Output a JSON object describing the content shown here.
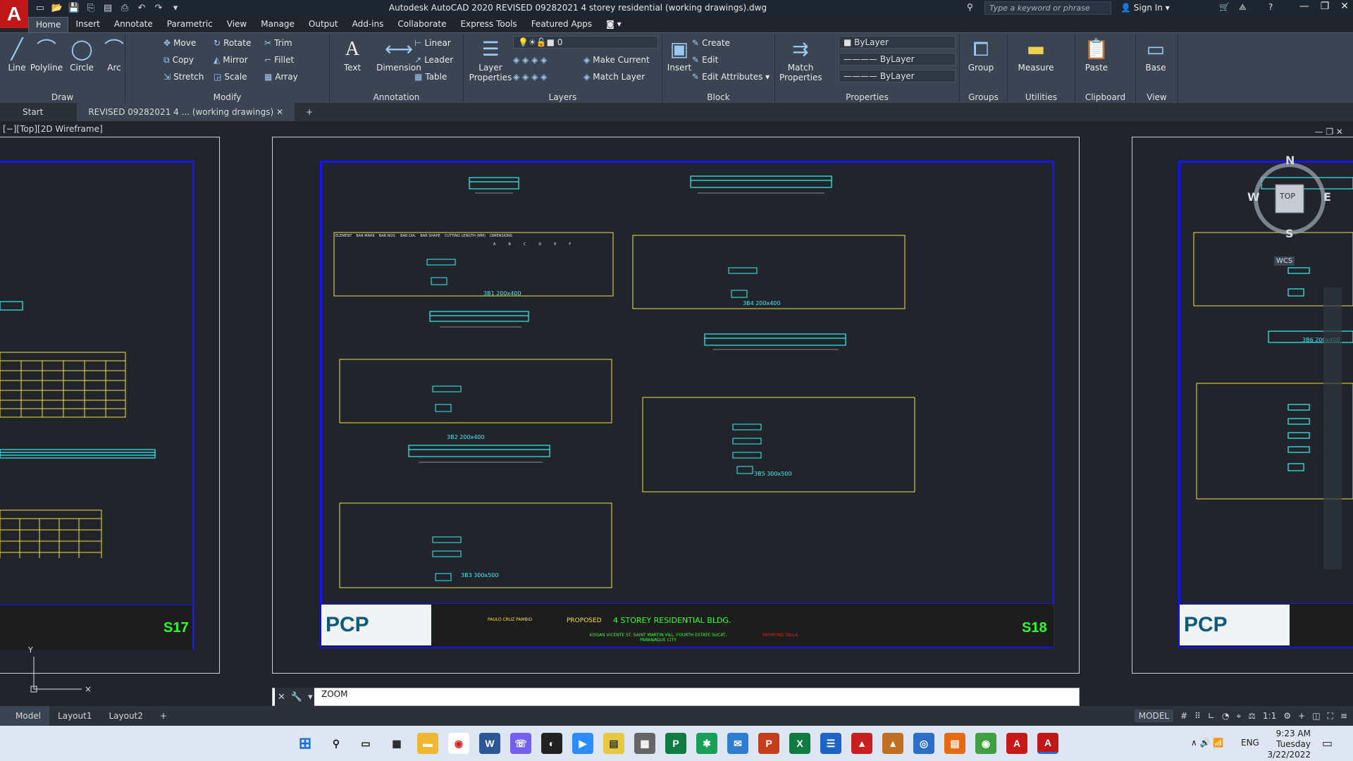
{
  "app": {
    "logo": "A",
    "title": "Autodesk AutoCAD 2020    REVISED 09282021 4 storey residential (working drawings).dwg"
  },
  "header": {
    "search_placeholder": "Type a keyword or phrase",
    "sign_in": "Sign In"
  },
  "ribbon_tabs": [
    "Home",
    "Insert",
    "Annotate",
    "Parametric",
    "View",
    "Manage",
    "Output",
    "Add-ins",
    "Collaborate",
    "Express Tools",
    "Featured Apps"
  ],
  "panels": {
    "draw": {
      "title": "Draw",
      "line": "Line",
      "polyline": "Polyline",
      "circle": "Circle",
      "arc": "Arc"
    },
    "modify": {
      "title": "Modify",
      "move": "Move",
      "rotate": "Rotate",
      "trim": "Trim",
      "copy": "Copy",
      "mirror": "Mirror",
      "fillet": "Fillet",
      "stretch": "Stretch",
      "scale": "Scale",
      "array": "Array"
    },
    "annotation": {
      "title": "Annotation",
      "text": "Text",
      "dimension": "Dimension",
      "linear": "Linear",
      "leader": "Leader",
      "table": "Table"
    },
    "layers": {
      "title": "Layers",
      "layer_properties": "Layer Properties",
      "current_layer": "0",
      "make_current": "Make Current",
      "match_layer": "Match Layer"
    },
    "block": {
      "title": "Block",
      "insert": "Insert",
      "create": "Create",
      "edit": "Edit",
      "edit_attributes": "Edit Attributes"
    },
    "properties": {
      "title": "Properties",
      "match_properties": "Match Properties",
      "color": "ByLayer",
      "linetype": "ByLayer",
      "lineweight": "ByLayer"
    },
    "groups": {
      "title": "Groups",
      "group": "Group"
    },
    "utilities": {
      "title": "Utilities",
      "measure": "Measure"
    },
    "clipboard": {
      "title": "Clipboard",
      "paste": "Paste"
    },
    "view": {
      "title": "View",
      "base": "Base"
    }
  },
  "file_tabs": {
    "start": "Start",
    "active": "REVISED 09282021 4 ... (working drawings)"
  },
  "viewport": {
    "label": "[−][Top][2D Wireframe]"
  },
  "compass": {
    "n": "N",
    "s": "S",
    "e": "E",
    "w": "W",
    "top": "TOP",
    "wcs": "WCS"
  },
  "sheets": {
    "left": {
      "number": "S17"
    },
    "center": {
      "number": "S18",
      "project_title": "4 STOREY RESIDENTIAL BLDG.",
      "proposed": "PROPOSED",
      "engineer": "PAULO CRUZ PAMBID",
      "owner": "RAYMOND TALLA",
      "location": "KISSAN VICENTE ST. SAINT MARTIN VILL. FOURTH ESTATE SUCAT, PARANAQUE CITY",
      "beam_labels": [
        "3B1 200x400",
        "3B2 200x400",
        "3B3 300x500",
        "3B4 200x400",
        "3B5 300x500"
      ],
      "table_header": [
        "ELEMENT",
        "BAR MARK",
        "BAR NOS.",
        "BAR DIA.",
        "BAR SHAPE",
        "CUTTING LENGTH (MM)",
        "DIMENSIONS"
      ],
      "dim_cols": [
        "A",
        "B",
        "C",
        "D",
        "E",
        "F"
      ]
    },
    "right": {
      "beam_label": "3B6 200x400"
    }
  },
  "logo_text": "PCP",
  "command": {
    "input": "ZOOM"
  },
  "layout_tabs": [
    "Model",
    "Layout1",
    "Layout2"
  ],
  "status": {
    "model": "MODEL",
    "scale": "1:1"
  },
  "taskbar": {
    "lang": "ENG",
    "time": "9:23 AM",
    "day": "Tuesday",
    "date": "3/22/2022"
  }
}
